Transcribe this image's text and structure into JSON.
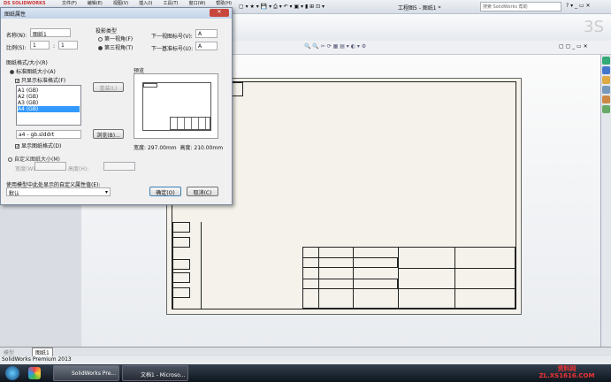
{
  "app": {
    "title": "工程图5 - 图纸1 *",
    "search_placeholder": "搜索 SolidWorks 帮助",
    "menus": [
      "文件(F)",
      "编辑(E)",
      "视图(V)",
      "插入(I)",
      "工具(T)",
      "窗口(W)",
      "帮助(H)"
    ]
  },
  "dialog": {
    "title": "图纸属性",
    "close": "✕",
    "name_label": "名称(N):",
    "name_value": "图纸1",
    "scale_label": "比例(S):",
    "scale_a": "1",
    "scale_sep": ":",
    "scale_b": "1",
    "projection_label": "投影类型",
    "first_angle": "第一视角(F)",
    "third_angle": "第三视角(T)",
    "projection_selected": "third",
    "next_view_label": "下一视图标号(V):",
    "next_view_value": "A",
    "next_datum_label": "下一基准标号(U):",
    "next_datum_value": "A",
    "format_label": "图纸格式/大小(R)",
    "standard_size": "标准图纸大小(A)",
    "only_standard": "只显示标准格式(F)",
    "sizes": [
      "A1 (GB)",
      "A2 (GB)",
      "A3 (GB)",
      "A4 (GB)"
    ],
    "selected_size": "A4 (GB)",
    "reload": "重装(L)",
    "format_file": "a4 - gb.slddrt",
    "browse": "浏览(B)...",
    "show_format": "显示图纸格式(D)",
    "custom_size": "自定义图纸大小(M)",
    "width_label": "宽度(W):",
    "height_label": "高度(H):",
    "preview_label": "预览",
    "width_readout_label": "宽度:",
    "width_readout": "297.00mm",
    "height_readout_label": "高度:",
    "height_readout": "210.00mm",
    "custom_prop_label": "使用模型中此处显示的自定义属性值(E):",
    "custom_prop_value": "默认",
    "ok": "确定(O)",
    "cancel": "取消(C)"
  },
  "tabs": {
    "model": "模型",
    "sheet": "图纸1"
  },
  "status": "SolidWorks Premium 2013",
  "taskbar": {
    "items": [
      "SolidWorks Pre...",
      "文档1 - Microso..."
    ]
  },
  "watermark": "资料网 ZL.XS1616.COM",
  "colors": {
    "selection": "#3399ff",
    "sheet": "#f4f2ea",
    "close": "#c8473d"
  }
}
